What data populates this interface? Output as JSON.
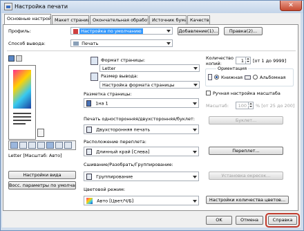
{
  "window": {
    "title": "Настройка печати",
    "close_glyph": "✕"
  },
  "tabs": [
    "Основные настройки",
    "Макет страницы",
    "Окончательная обработка",
    "Источник бумаги",
    "Качество"
  ],
  "profile": {
    "label": "Профиль:",
    "value": "Настройка по умолчанию",
    "add_btn": "Добавление(1)...",
    "edit_btn": "Правка(2)..."
  },
  "output": {
    "label": "Способ вывода:",
    "value": "Печать"
  },
  "page_size": {
    "label": "Формат страницы:",
    "value": "Letter"
  },
  "output_size": {
    "label": "Размер вывода:",
    "value": "Настройка формата страницы"
  },
  "copies": {
    "label_line1": "Количество",
    "label_line2": "копий:",
    "value": "1",
    "range": "[от 1 до 9999]"
  },
  "orientation": {
    "title": "Ориентация",
    "portrait": "Книжная",
    "landscape": "Альбомная"
  },
  "layout": {
    "label": "Разметка страницы:",
    "value": "1на 1"
  },
  "manual_scale": {
    "label": "Ручная настройка масштаба",
    "scale_label": "Масштаб:",
    "value": "100",
    "range": "% [от 25 до 200]"
  },
  "duplex": {
    "label": "Печать односторонняя/двухсторонняя/буклет:",
    "value": "Двухсторонняя печать",
    "booklet_btn": "Буклет..."
  },
  "binding": {
    "label": "Расположение переплета:",
    "value": "Длинный край [Слева]",
    "margin_btn": "Переплет..."
  },
  "finishing": {
    "label": "Сшивание/Разобрать/Группирование:",
    "value": "Группирование",
    "offset_btn": "Установка окресок..."
  },
  "color_mode": {
    "label": "Цветовой режим:",
    "value": "Авто [Цвет/Ч/Б]",
    "color_btn": "Настройки количества цветов..."
  },
  "preview": {
    "caption": "Letter [Масштаб: Авто]",
    "view_btn": "Настройки вида",
    "restore_btn": "Восс. параметры по умолчанию"
  },
  "footer": {
    "ok": "OK",
    "cancel": "Отмена",
    "help": "Справка"
  },
  "colors": {
    "accent": "#3399ff",
    "help_highlight": "#c0392b"
  }
}
